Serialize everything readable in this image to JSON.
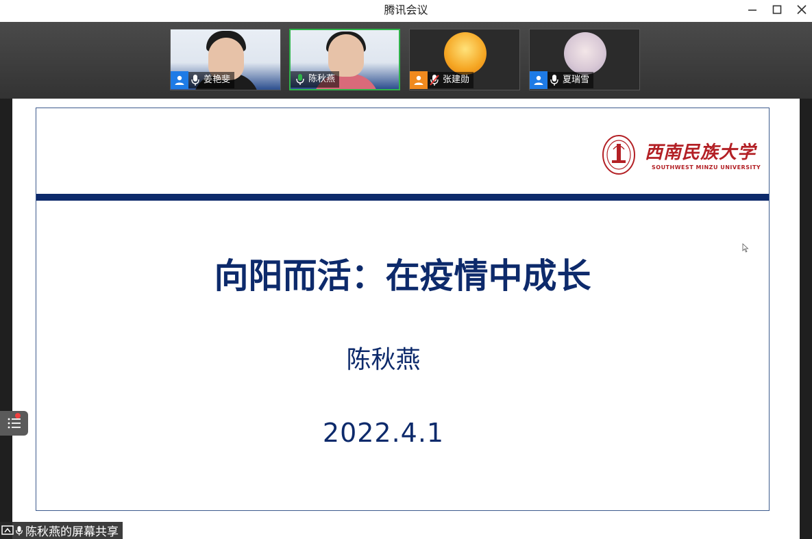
{
  "window": {
    "title": "腾讯会议"
  },
  "participants": [
    {
      "name": "姜艳斐",
      "has_video": true,
      "active": false
    },
    {
      "name": "陈秋燕",
      "has_video": true,
      "active": true
    },
    {
      "name": "张建勋",
      "has_video": false,
      "muted": true
    },
    {
      "name": "夏瑞雪",
      "has_video": false,
      "muted": false
    }
  ],
  "slide": {
    "logo_cn": "西南民族大学",
    "logo_en": "SOUTHWEST MINZU UNIVERSITY",
    "title": "向阳而活：在疫情中成长",
    "presenter": "陈秋燕",
    "date": "2022.4.1"
  },
  "share_badge": {
    "label": "陈秋燕的屏幕共享"
  },
  "colors": {
    "slide_blue": "#0d2a6b",
    "brand_red": "#b32025",
    "active_green": "#2fb34a",
    "user_blue": "#1e7be6",
    "user_orange": "#f08a1e"
  }
}
